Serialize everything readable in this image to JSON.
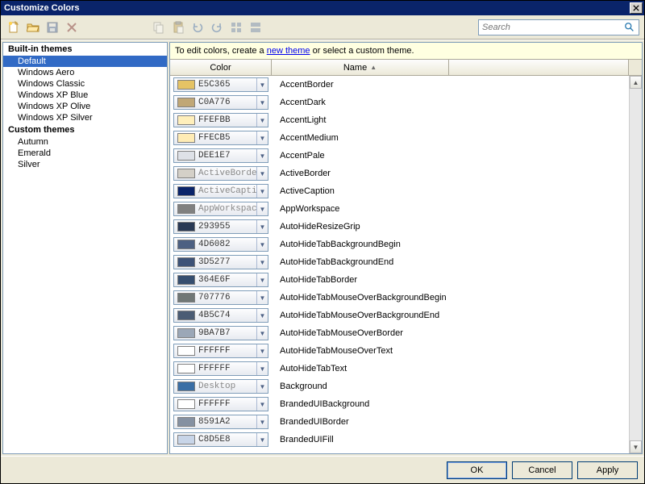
{
  "window": {
    "title": "Customize Colors"
  },
  "search": {
    "placeholder": "Search"
  },
  "info": {
    "prefix": "To edit colors, create a ",
    "link": "new theme",
    "suffix": " or select a custom theme."
  },
  "headers": {
    "color": "Color",
    "name": "Name"
  },
  "sidebar": [
    {
      "type": "cat",
      "label": "Built-in themes"
    },
    {
      "type": "item",
      "label": "Default",
      "selected": true
    },
    {
      "type": "item",
      "label": "Windows Aero"
    },
    {
      "type": "item",
      "label": "Windows Classic"
    },
    {
      "type": "item",
      "label": "Windows XP Blue"
    },
    {
      "type": "item",
      "label": "Windows XP Olive"
    },
    {
      "type": "item",
      "label": "Windows XP Silver"
    },
    {
      "type": "cat",
      "label": "Custom themes"
    },
    {
      "type": "item",
      "label": "Autumn"
    },
    {
      "type": "item",
      "label": "Emerald"
    },
    {
      "type": "item",
      "label": "Silver"
    }
  ],
  "rows": [
    {
      "hex": "E5C365",
      "swatch": "#e5c365",
      "name": "AccentBorder"
    },
    {
      "hex": "C0A776",
      "swatch": "#c0a776",
      "name": "AccentDark"
    },
    {
      "hex": "FFEFBB",
      "swatch": "#ffefbb",
      "name": "AccentLight"
    },
    {
      "hex": "FFECB5",
      "swatch": "#ffecb5",
      "name": "AccentMedium"
    },
    {
      "hex": "DEE1E7",
      "swatch": "#dee1e7",
      "name": "AccentPale"
    },
    {
      "hex": "ActiveBorder",
      "swatch": "#d4d0c8",
      "name": "ActiveBorder",
      "sys": true
    },
    {
      "hex": "ActiveCaption",
      "swatch": "#0a246a",
      "name": "ActiveCaption",
      "sys": true
    },
    {
      "hex": "AppWorkspace",
      "swatch": "#808080",
      "name": "AppWorkspace",
      "sys": true
    },
    {
      "hex": "293955",
      "swatch": "#293955",
      "name": "AutoHideResizeGrip"
    },
    {
      "hex": "4D6082",
      "swatch": "#4d6082",
      "name": "AutoHideTabBackgroundBegin"
    },
    {
      "hex": "3D5277",
      "swatch": "#3d5277",
      "name": "AutoHideTabBackgroundEnd"
    },
    {
      "hex": "364E6F",
      "swatch": "#364e6f",
      "name": "AutoHideTabBorder"
    },
    {
      "hex": "707776",
      "swatch": "#707776",
      "name": "AutoHideTabMouseOverBackgroundBegin"
    },
    {
      "hex": "4B5C74",
      "swatch": "#4b5c74",
      "name": "AutoHideTabMouseOverBackgroundEnd"
    },
    {
      "hex": "9BA7B7",
      "swatch": "#9ba7b7",
      "name": "AutoHideTabMouseOverBorder"
    },
    {
      "hex": "FFFFFF",
      "swatch": "#ffffff",
      "name": "AutoHideTabMouseOverText"
    },
    {
      "hex": "FFFFFF",
      "swatch": "#ffffff",
      "name": "AutoHideTabText"
    },
    {
      "hex": "Desktop",
      "swatch": "#3a6ea5",
      "name": "Background",
      "sys": true
    },
    {
      "hex": "FFFFFF",
      "swatch": "#ffffff",
      "name": "BrandedUIBackground"
    },
    {
      "hex": "8591A2",
      "swatch": "#8591a2",
      "name": "BrandedUIBorder"
    },
    {
      "hex": "C8D5E8",
      "swatch": "#c8d5e8",
      "name": "BrandedUIFill"
    }
  ],
  "buttons": {
    "ok": "OK",
    "cancel": "Cancel",
    "apply": "Apply"
  }
}
